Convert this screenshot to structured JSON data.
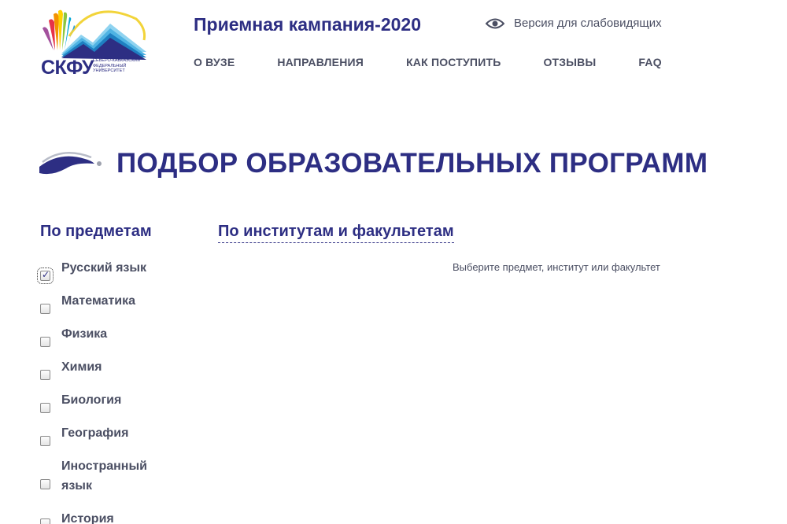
{
  "logo": {
    "abbr": "СКФУ",
    "full_name": "Северо-Кавказский\nфедеральный\nуниверситет"
  },
  "header": {
    "campaign_title": "Приемная кампания-2020",
    "accessibility_link": "Версия для слабовидящих",
    "accessibility_icon": "eye-icon"
  },
  "nav": [
    {
      "label": "О ВУЗЕ"
    },
    {
      "label": "НАПРАВЛЕНИЯ"
    },
    {
      "label": "КАК ПОСТУПИТЬ"
    },
    {
      "label": "ОТЗЫВЫ"
    },
    {
      "label": "FAQ"
    }
  ],
  "page": {
    "title": "ПОДБОР ОБРАЗОВАТЕЛЬНЫХ ПРОГРАММ",
    "tab_subjects": "По предметам",
    "tab_institutes": "По институтам и факультетам",
    "hint": "Выберите предмет, институт или факультет"
  },
  "subjects": [
    {
      "label": "Русский язык",
      "checked": true
    },
    {
      "label": "Математика",
      "checked": false
    },
    {
      "label": "Физика",
      "checked": false
    },
    {
      "label": "Химия",
      "checked": false
    },
    {
      "label": "Биология",
      "checked": false
    },
    {
      "label": "География",
      "checked": false
    },
    {
      "label": "Иностранный язык",
      "checked": false
    },
    {
      "label": "История",
      "checked": false
    }
  ],
  "colors": {
    "brand": "#2d2e83",
    "text": "#4b4f63",
    "accent_yellow": "#f2d43a"
  }
}
